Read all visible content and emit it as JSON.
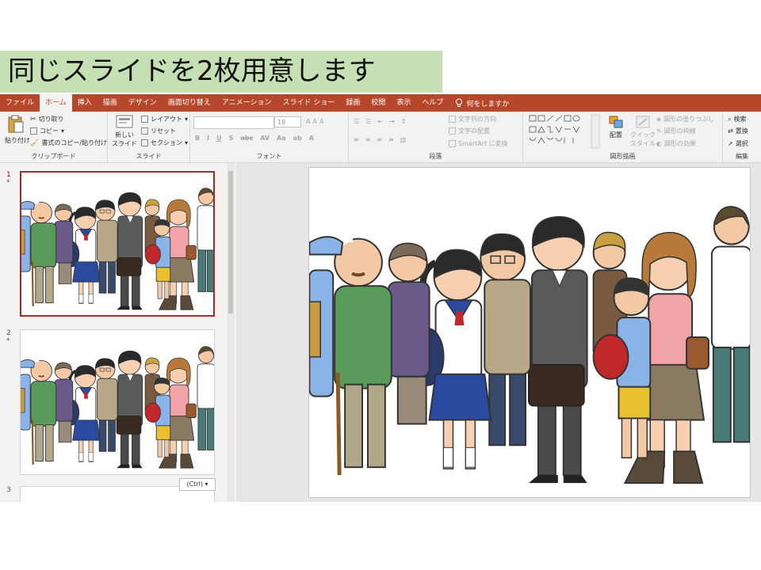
{
  "banner": {
    "text": "同じスライドを2枚用意します"
  },
  "ribbon_tabs": [
    "ファイル",
    "ホーム",
    "挿入",
    "描画",
    "デザイン",
    "画面切り替え",
    "アニメーション",
    "スライド ショー",
    "録画",
    "校閲",
    "表示",
    "ヘルプ"
  ],
  "active_tab": "ホーム",
  "help_text": "何をしますか",
  "clipboard": {
    "paste": "貼り付け",
    "cut": "切り取り",
    "copy": "コピー",
    "format_painter": "書式のコピー/貼り付け",
    "label": "クリップボード"
  },
  "slides_group": {
    "new_slide_1": "新しい",
    "new_slide_2": "スライド",
    "layout": "レイアウト",
    "reset": "リセット",
    "section": "セクション",
    "label": "スライド"
  },
  "font_group": {
    "size": "18",
    "label": "フォント"
  },
  "paragraph_group": {
    "text_direction": "文字列の方向",
    "align_text": "文字の配置",
    "smartart": "SmartArt に変換",
    "label": "段落"
  },
  "drawing_group": {
    "arrange": "配置",
    "quick_styles_1": "クイック",
    "quick_styles_2": "スタイル",
    "shape_fill": "図形の塗りつぶし",
    "shape_outline": "図形の枠線",
    "shape_effects": "図形の効果",
    "label": "図形描画"
  },
  "editing_group": {
    "find": "検索",
    "replace": "置換",
    "select": "選択",
    "label": "編集"
  },
  "slides": [
    {
      "number": "1",
      "star": "*"
    },
    {
      "number": "2",
      "star": "*"
    },
    {
      "number": "3",
      "star": ""
    }
  ],
  "paste_options": "(Ctrl)",
  "colors": {
    "ribbon": "#b7472a",
    "banner": "#c5e0b4",
    "selected_border": "#a52a2a"
  }
}
